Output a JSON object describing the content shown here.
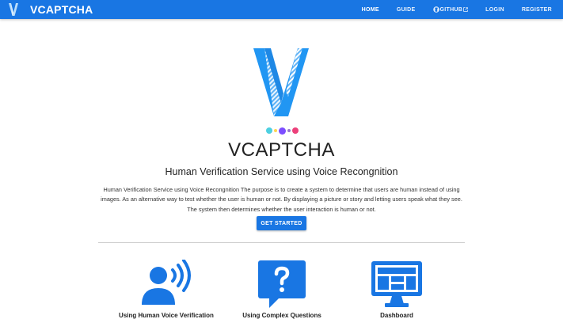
{
  "navbar": {
    "brand": "VCAPTCHA",
    "items": [
      {
        "label": "HOME",
        "active": true
      },
      {
        "label": "GUIDE"
      },
      {
        "label": "GITHUB"
      },
      {
        "label": "LOGIN"
      },
      {
        "label": "REGISTER"
      }
    ]
  },
  "hero": {
    "title": "VCAPTCHA",
    "subtitle": "Human Verification Service using Voice Recongnition",
    "description": "Human Verification Service using Voice Recongnition The purpose is to create a system to determine that users are human instead of using images. As an alternative way to test whether the user is human or not. By displaying a picture or story and letting users speak what they see. The system then determines whether the user interaction is human or not.",
    "cta_label": "GET STARTED",
    "dots": [
      "#4dd0e1",
      "#ffd54f",
      "#7c4dff",
      "#9575cd",
      "#ec407a"
    ]
  },
  "features": [
    {
      "label": "Using Human Voice Verification",
      "icon": "voice-user-icon"
    },
    {
      "label": "Using Complex Questions",
      "icon": "question-chat-icon"
    },
    {
      "label": "Dashboard",
      "icon": "monitor-dashboard-icon"
    }
  ],
  "colors": {
    "primary": "#1976e3",
    "logo_light": "#64b5f6",
    "logo": "#2196f3"
  }
}
